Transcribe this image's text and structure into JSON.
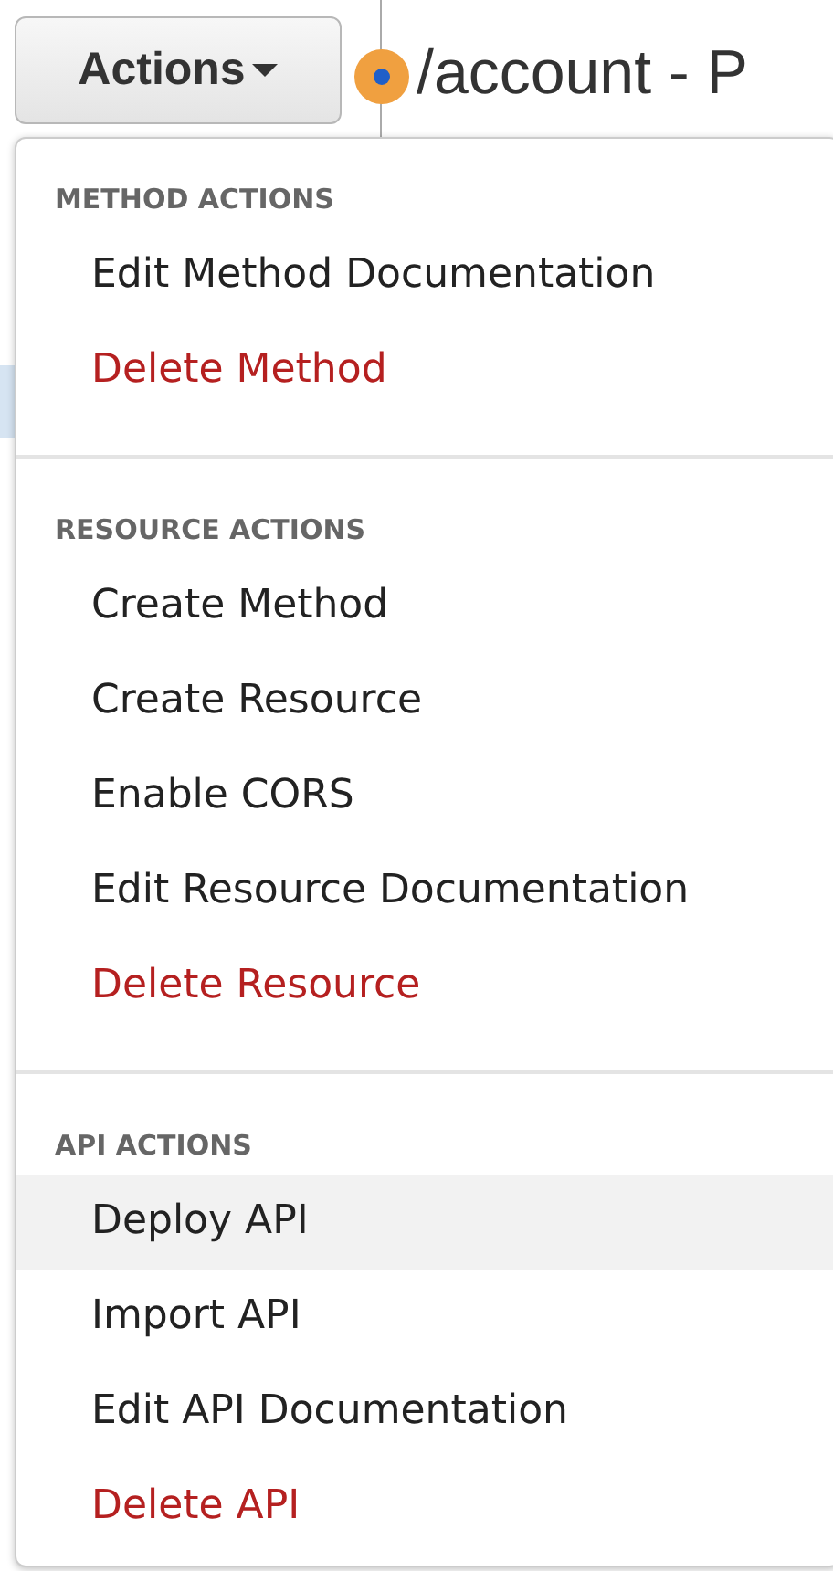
{
  "toolbar": {
    "actions_button": {
      "label": "Actions",
      "expanded": true
    },
    "resource_title": "/account - P"
  },
  "menu": {
    "sections": [
      {
        "header": "METHOD ACTIONS",
        "items": [
          {
            "label": "Edit Method Documentation",
            "kind": "normal",
            "highlighted": false
          },
          {
            "label": "Delete Method",
            "kind": "danger",
            "highlighted": false
          }
        ]
      },
      {
        "header": "RESOURCE ACTIONS",
        "items": [
          {
            "label": "Create Method",
            "kind": "normal",
            "highlighted": false
          },
          {
            "label": "Create Resource",
            "kind": "normal",
            "highlighted": false
          },
          {
            "label": "Enable CORS",
            "kind": "normal",
            "highlighted": false
          },
          {
            "label": "Edit Resource Documentation",
            "kind": "normal",
            "highlighted": false
          },
          {
            "label": "Delete Resource",
            "kind": "danger",
            "highlighted": false
          }
        ]
      },
      {
        "header": "API ACTIONS",
        "items": [
          {
            "label": "Deploy API",
            "kind": "normal",
            "highlighted": true
          },
          {
            "label": "Import API",
            "kind": "normal",
            "highlighted": false
          },
          {
            "label": "Edit API Documentation",
            "kind": "normal",
            "highlighted": false
          },
          {
            "label": "Delete API",
            "kind": "danger",
            "highlighted": false
          }
        ]
      }
    ]
  }
}
